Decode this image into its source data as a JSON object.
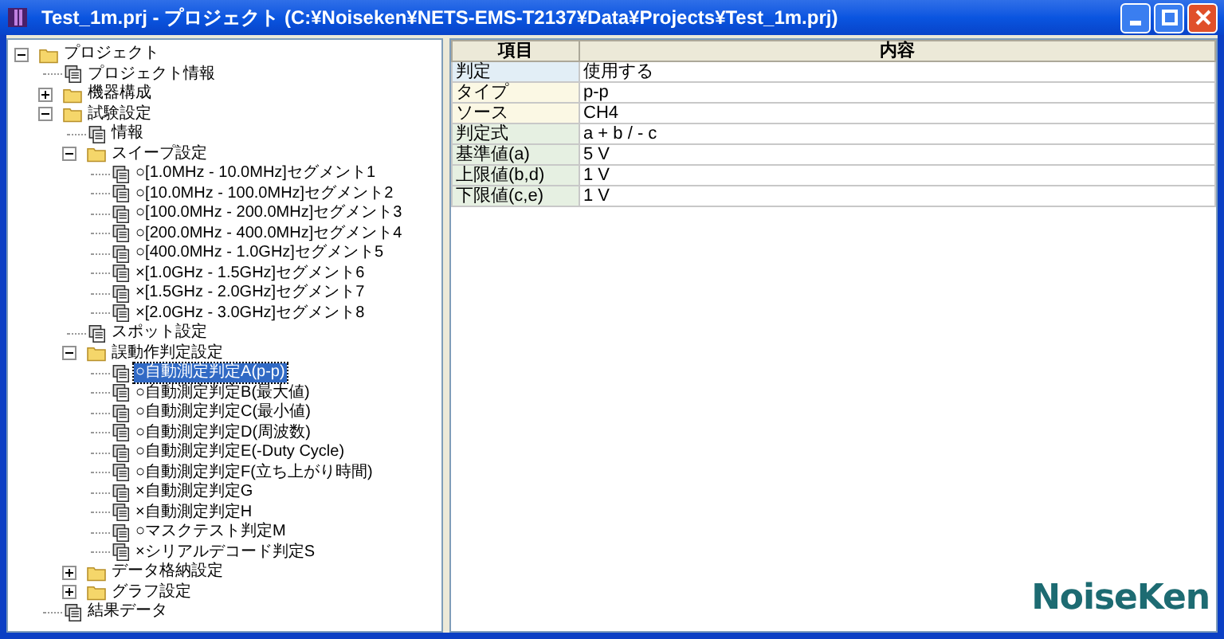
{
  "window": {
    "title": "Test_1m.prj - プロジェクト (C:¥Noiseken¥NETS-EMS-T2137¥Data¥Projects¥Test_1m.prj)"
  },
  "tree": [
    {
      "kind": "folder",
      "label": "プロジェクト",
      "expanded": true,
      "selected": false,
      "children": [
        {
          "kind": "page",
          "label": "プロジェクト情報",
          "selected": false
        },
        {
          "kind": "folder",
          "label": "機器構成",
          "expanded": false,
          "selected": false
        },
        {
          "kind": "folder",
          "label": "試験設定",
          "expanded": true,
          "selected": false,
          "children": [
            {
              "kind": "page",
              "label": "情報",
              "selected": false
            },
            {
              "kind": "folder",
              "label": "スイープ設定",
              "expanded": true,
              "selected": false,
              "children": [
                {
                  "kind": "page",
                  "label": "○[1.0MHz - 10.0MHz]セグメント1",
                  "selected": false
                },
                {
                  "kind": "page",
                  "label": "○[10.0MHz - 100.0MHz]セグメント2",
                  "selected": false
                },
                {
                  "kind": "page",
                  "label": "○[100.0MHz - 200.0MHz]セグメント3",
                  "selected": false
                },
                {
                  "kind": "page",
                  "label": "○[200.0MHz - 400.0MHz]セグメント4",
                  "selected": false
                },
                {
                  "kind": "page",
                  "label": "○[400.0MHz - 1.0GHz]セグメント5",
                  "selected": false
                },
                {
                  "kind": "page",
                  "label": "×[1.0GHz - 1.5GHz]セグメント6",
                  "selected": false
                },
                {
                  "kind": "page",
                  "label": "×[1.5GHz - 2.0GHz]セグメント7",
                  "selected": false
                },
                {
                  "kind": "page",
                  "label": "×[2.0GHz - 3.0GHz]セグメント8",
                  "selected": false
                }
              ]
            },
            {
              "kind": "page",
              "label": "スポット設定",
              "selected": false
            },
            {
              "kind": "folder",
              "label": "誤動作判定設定",
              "expanded": true,
              "selected": false,
              "children": [
                {
                  "kind": "page",
                  "label": "○自動測定判定A(p-p)",
                  "selected": true
                },
                {
                  "kind": "page",
                  "label": "○自動測定判定B(最大値)",
                  "selected": false
                },
                {
                  "kind": "page",
                  "label": "○自動測定判定C(最小値)",
                  "selected": false
                },
                {
                  "kind": "page",
                  "label": "○自動測定判定D(周波数)",
                  "selected": false
                },
                {
                  "kind": "page",
                  "label": "○自動測定判定E(-Duty Cycle)",
                  "selected": false
                },
                {
                  "kind": "page",
                  "label": "○自動測定判定F(立ち上がり時間)",
                  "selected": false
                },
                {
                  "kind": "page",
                  "label": "×自動測定判定G",
                  "selected": false
                },
                {
                  "kind": "page",
                  "label": "×自動測定判定H",
                  "selected": false
                },
                {
                  "kind": "page",
                  "label": "○マスクテスト判定M",
                  "selected": false
                },
                {
                  "kind": "page",
                  "label": "×シリアルデコード判定S",
                  "selected": false
                }
              ]
            },
            {
              "kind": "folder",
              "label": "データ格納設定",
              "expanded": false,
              "selected": false
            },
            {
              "kind": "folder",
              "label": "グラフ設定",
              "expanded": false,
              "selected": false
            }
          ]
        },
        {
          "kind": "page",
          "label": "結果データ",
          "selected": false
        }
      ]
    }
  ],
  "table": {
    "columns": [
      "項目",
      "内容"
    ],
    "rows": [
      {
        "item": "判定",
        "value": "使用する",
        "color": "#e2eef6"
      },
      {
        "item": "タイプ",
        "value": "p-p",
        "color": "#fbf8e4"
      },
      {
        "item": "ソース",
        "value": "CH4",
        "color": "#fbf8e4"
      },
      {
        "item": "判定式",
        "value": "a + b / - c",
        "color": "#e6f0e2"
      },
      {
        "item": "基準値(a)",
        "value": "5 V",
        "color": "#e6f0e2"
      },
      {
        "item": "上限値(b,d)",
        "value": "1 V",
        "color": "#e6f0e2"
      },
      {
        "item": "下限値(c,e)",
        "value": "1 V",
        "color": "#e6f0e2"
      }
    ]
  },
  "logo": "NoiseKen"
}
